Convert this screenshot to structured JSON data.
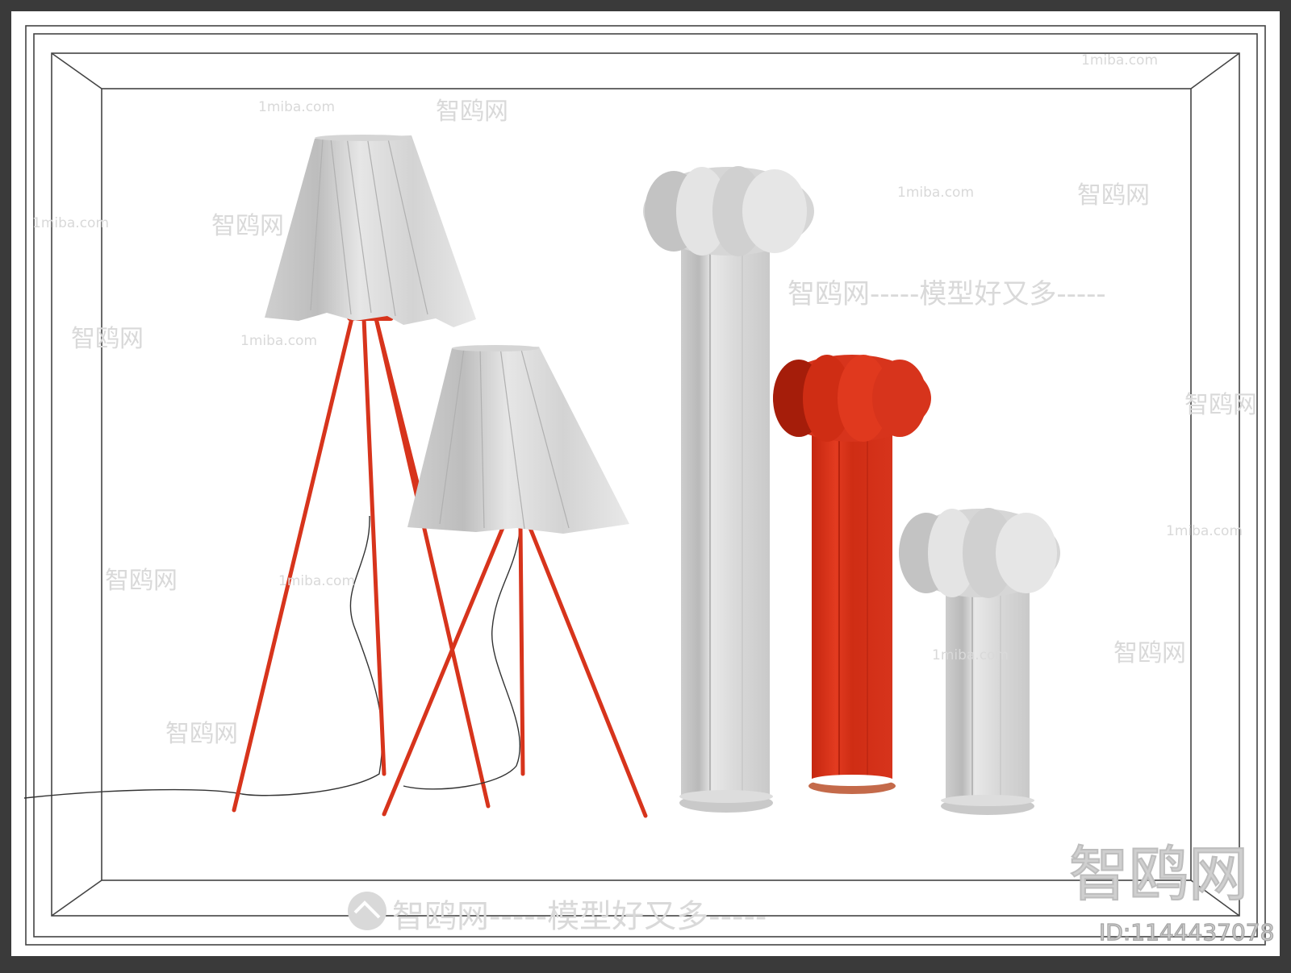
{
  "watermark": {
    "site": "1miba.com",
    "cn_brand": "智鸥网",
    "slogan": "智鸥网-----模型好又多-----",
    "corner_logo": "智鸥网",
    "id_label": "ID:1144437078"
  },
  "scene": {
    "description_colors": {
      "background_frame": "#3a3a3a",
      "canvas": "#ffffff",
      "shade_light": "#e3e3e3",
      "shade_shadow": "#bdbdbd",
      "accent_red": "#d7341c",
      "accent_red_dark": "#b8220f"
    },
    "objects": [
      {
        "name": "tall-tripod-floor-lamp"
      },
      {
        "name": "short-tripod-floor-lamp"
      },
      {
        "name": "tall-white-pillar-lamp"
      },
      {
        "name": "medium-red-pillar-lamp"
      },
      {
        "name": "short-white-pillar-lamp"
      }
    ]
  }
}
